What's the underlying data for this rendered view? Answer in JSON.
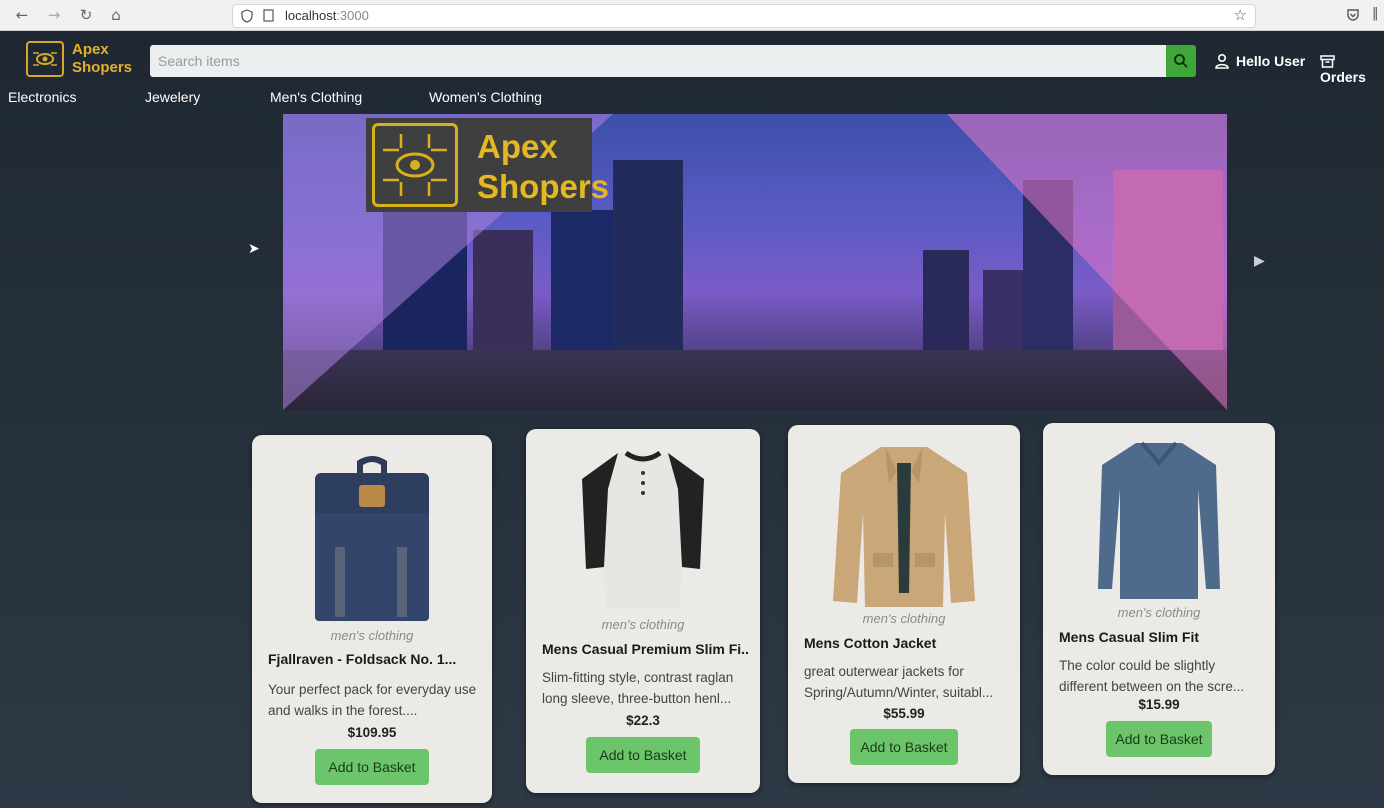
{
  "browser": {
    "url_host": "localhost",
    "url_port": ":3000"
  },
  "header": {
    "logo_line1": "Apex",
    "logo_line2": "Shopers",
    "search_placeholder": "Search items",
    "user_label": "Hello User",
    "orders_label": "Orders"
  },
  "categories": [
    "Electronics",
    "Jewelery",
    "Men's Clothing",
    "Women's Clothing"
  ],
  "banner": {
    "logo_line1": "Apex",
    "logo_line2": "Shopers"
  },
  "products": [
    {
      "category": "men's clothing",
      "title": "Fjallraven - Foldsack No. 1...",
      "description": "Your perfect pack for everyday use and walks in the forest....",
      "price": "$109.95",
      "button": "Add to Basket",
      "icon": "backpack-image"
    },
    {
      "category": "men's clothing",
      "title": "Mens Casual Premium Slim Fi...",
      "description": "Slim-fitting style, contrast raglan long sleeve, three-button henl...",
      "price": "$22.3",
      "button": "Add to Basket",
      "icon": "henley-shirt-image"
    },
    {
      "category": "men's clothing",
      "title": "Mens Cotton Jacket",
      "description": "great outerwear jackets for Spring/Autumn/Winter, suitabl...",
      "price": "$55.99",
      "button": "Add to Basket",
      "icon": "jacket-image"
    },
    {
      "category": "men's clothing",
      "title": "Mens Casual Slim Fit",
      "description": "The color could be slightly different between on the scre...",
      "price": "$15.99",
      "button": "Add to Basket",
      "icon": "tshirt-image"
    }
  ],
  "colors": {
    "brand_gold": "#e2b02c",
    "search_button": "#3fa63a",
    "add_button": "#6cc56b"
  }
}
